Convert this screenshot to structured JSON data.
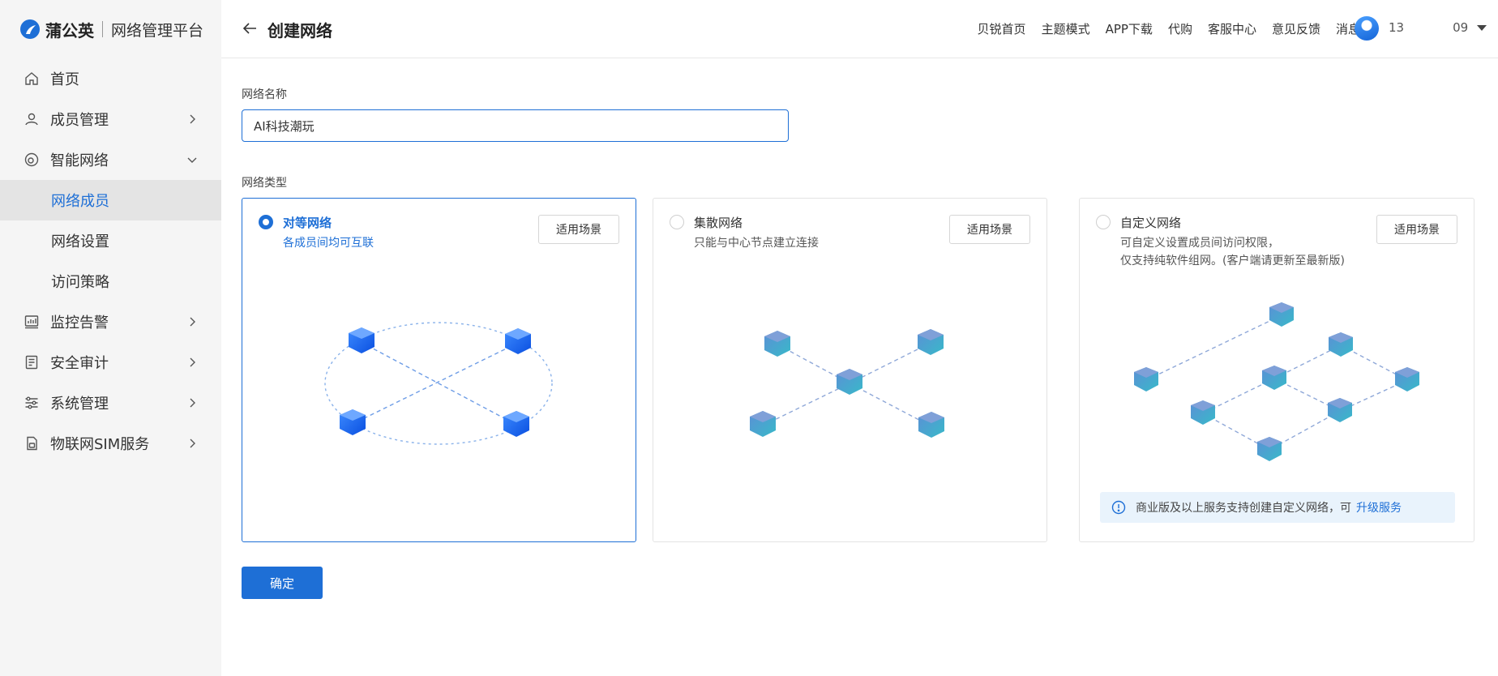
{
  "brand": {
    "name": "蒲公英",
    "subtitle": "网络管理平台",
    "accent": "#1e6fd6"
  },
  "sidebar": {
    "items": [
      {
        "label": "首页",
        "icon": "home-icon",
        "chevron": "none"
      },
      {
        "label": "成员管理",
        "icon": "user-icon",
        "chevron": "right"
      },
      {
        "label": "智能网络",
        "icon": "network-icon",
        "chevron": "down"
      },
      {
        "label": "网络成员",
        "sub": true,
        "active": true
      },
      {
        "label": "网络设置",
        "sub": true
      },
      {
        "label": "访问策略",
        "sub": true
      },
      {
        "label": "监控告警",
        "icon": "monitor-icon",
        "chevron": "right"
      },
      {
        "label": "安全审计",
        "icon": "audit-icon",
        "chevron": "right"
      },
      {
        "label": "系统管理",
        "icon": "settings-sliders-icon",
        "chevron": "right"
      },
      {
        "label": "物联网SIM服务",
        "icon": "sim-card-icon",
        "chevron": "right"
      }
    ]
  },
  "header": {
    "title": "创建网络",
    "links": [
      "贝锐首页",
      "主题模式",
      "APP下载",
      "代购",
      "客服中心",
      "意见反馈",
      "消息"
    ],
    "user": "13    09"
  },
  "form": {
    "name_label": "网络名称",
    "name_value": "AI科技潮玩",
    "type_label": "网络类型",
    "confirm": "确定"
  },
  "cards": [
    {
      "title": "对等网络",
      "desc": [
        "各成员间均可互联"
      ],
      "button": "适用场景",
      "selected": true
    },
    {
      "title": "集散网络",
      "desc": [
        "只能与中心节点建立连接"
      ],
      "button": "适用场景",
      "selected": false
    },
    {
      "title": "自定义网络",
      "desc": [
        "可自定义设置成员间访问权限，",
        "仅支持纯软件组网。(客户端请更新至最新版)"
      ],
      "button": "适用场景",
      "selected": false
    }
  ],
  "notice": {
    "text": "商业版及以上服务支持创建自定义网络，可",
    "link": "升级服务"
  }
}
